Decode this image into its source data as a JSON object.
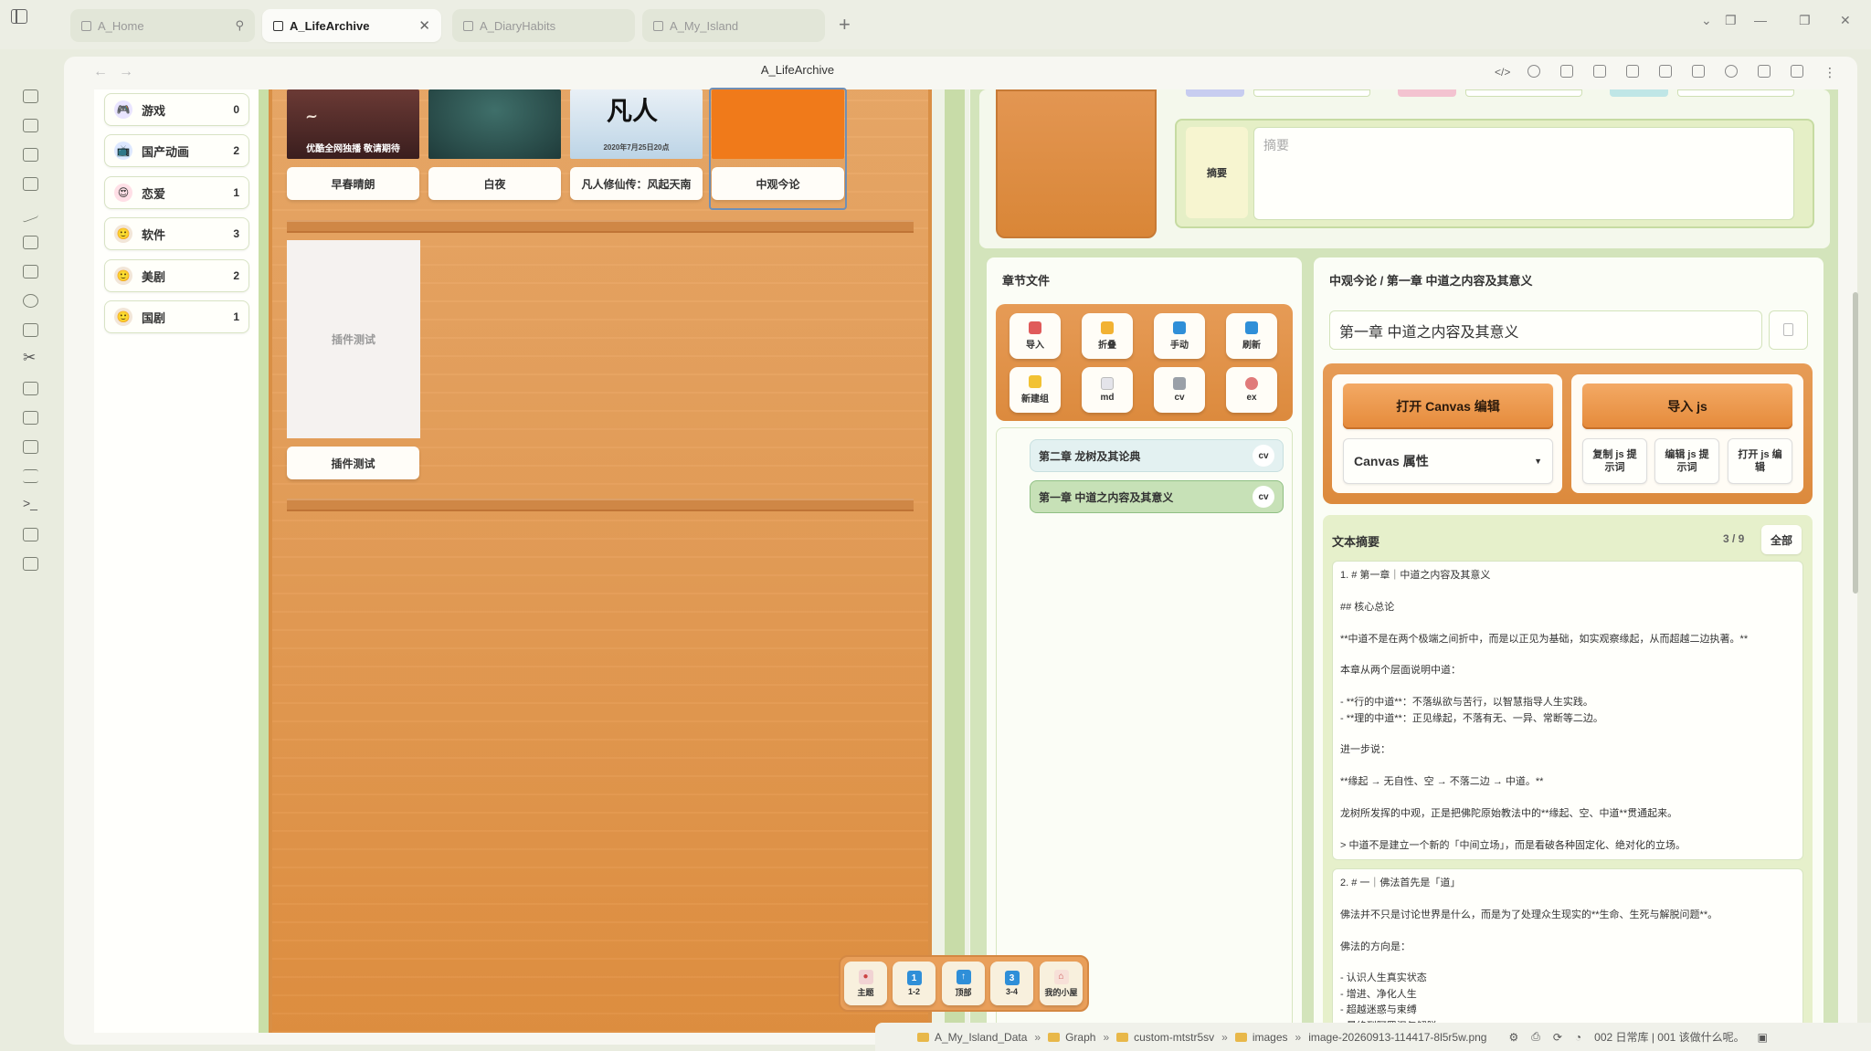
{
  "tabs": [
    {
      "label": "A_Home",
      "active": false,
      "pinned": true
    },
    {
      "label": "A_LifeArchive",
      "active": true
    },
    {
      "label": "A_DiaryHabits",
      "active": false
    },
    {
      "label": "A_My_Island",
      "active": false
    }
  ],
  "nav": {
    "title": "A_LifeArchive"
  },
  "categories": [
    {
      "label": "游戏",
      "count": "0",
      "emoji": "🎮",
      "color": "#e9e4ff"
    },
    {
      "label": "国产动画",
      "count": "2",
      "emoji": "📺",
      "color": "#dde8ff"
    },
    {
      "label": "恋爱",
      "count": "1",
      "emoji": "😍",
      "color": "#ffdfe6"
    },
    {
      "label": "软件",
      "count": "3",
      "emoji": "🙂",
      "color": "#f2e6d8"
    },
    {
      "label": "美剧",
      "count": "2",
      "emoji": "🙂",
      "color": "#f2e6d8"
    },
    {
      "label": "国剧",
      "count": "1",
      "emoji": "🙂",
      "color": "#f2e6d8"
    }
  ],
  "books": [
    {
      "label": "早春晴朗",
      "cover_text": "优酷全网独播 敬请期待"
    },
    {
      "label": "白夜",
      "cover_text": ""
    },
    {
      "label": "凡人修仙传：风起天南",
      "cover_text": "2020年7月25日20点"
    },
    {
      "label": "中观今论",
      "cover_text": ""
    }
  ],
  "plugin_card": {
    "cover": "插件测试",
    "label": "插件测试"
  },
  "summary": {
    "label": "摘要",
    "placeholder": "摘要"
  },
  "chapter_panel": {
    "title": "章节文件",
    "tools": [
      {
        "label": "导入",
        "color": "#e05a5a"
      },
      {
        "label": "折叠",
        "color": "#f2b233"
      },
      {
        "label": "手动",
        "color": "#2f8fd8"
      },
      {
        "label": "刷新",
        "color": "#2f8fd8"
      },
      {
        "label": "新建组",
        "color": "#f2c233"
      },
      {
        "label": "md",
        "color": "#cfcfd6"
      },
      {
        "label": "cv",
        "color": "#9aa0a8"
      },
      {
        "label": "ex",
        "color": "#e07a7a"
      }
    ],
    "chapters": [
      {
        "label": "第二章 龙树及其论典",
        "badge": "cv",
        "active": false
      },
      {
        "label": "第一章 中道之内容及其意义",
        "badge": "cv",
        "active": true
      }
    ]
  },
  "editor": {
    "breadcrumb": "中观今论 / 第一章 中道之内容及其意义",
    "title_value": "第一章 中道之内容及其意义",
    "open_canvas": "打开 Canvas 编辑",
    "import_js": "导入 js",
    "canvas_select": "Canvas 属性",
    "copy_js": "复制 js 提示词",
    "edit_js": "编辑 js 提示词",
    "open_js": "打开 js 编辑"
  },
  "text_summary": {
    "title": "文本摘要",
    "count": "3 / 9",
    "all_button": "全部",
    "card1": [
      "1. # 第一章｜中道之内容及其意义",
      "",
      "## 核心总论",
      "",
      "**中道不是在两个极端之间折中，而是以正见为基础，如实观察缘起，从而超越二边执著。**",
      "",
      "本章从两个层面说明中道：",
      "",
      "- **行的中道**：不落纵欲与苦行，以智慧指导人生实践。",
      "- **理的中道**：正见缘起，不落有无、一异、常断等二边。",
      "",
      "进一步说：",
      "",
      "**缘起 → 无自性、空 → 不落二边 → 中道。**",
      "",
      "龙树所发挥的中观，正是把佛陀原始教法中的**缘起、空、中道**贯通起来。",
      "",
      "> 中道不是建立一个新的「中间立场」，而是看破各种固定化、绝对化的立场。"
    ],
    "card2": [
      "2. # 一｜佛法首先是「道」",
      "",
      "佛法并不只是讨论世界是什么，而是为了处理众生现实的**生命、生死与解脱问题**。",
      "",
      "佛法的方向是：",
      "",
      "- 认识人生真实状态",
      "- 增进、净化人生",
      "- 超越迷惑与束缚",
      "- 最终到阿罗汉与解脱"
    ]
  },
  "dock": [
    {
      "label": "主题",
      "icon": "🎨",
      "color": "#f1d3d3"
    },
    {
      "label": "1-2",
      "icon": "1",
      "color": "#2f8fd8"
    },
    {
      "label": "顶部",
      "icon": "⬆",
      "color": "#2f8fd8"
    },
    {
      "label": "3-4",
      "icon": "3",
      "color": "#2f8fd8"
    },
    {
      "label": "我的小屋",
      "icon": "🏠",
      "color": "#f7e0d8"
    }
  ],
  "statusbar": {
    "crumbs": [
      "A_My_Island_Data",
      "Graph",
      "custom-mtstr5sv",
      "images",
      "image-20260913-114417-8l5r5w.png"
    ],
    "note": "002 日常库 | 001 该做什么呢。"
  }
}
